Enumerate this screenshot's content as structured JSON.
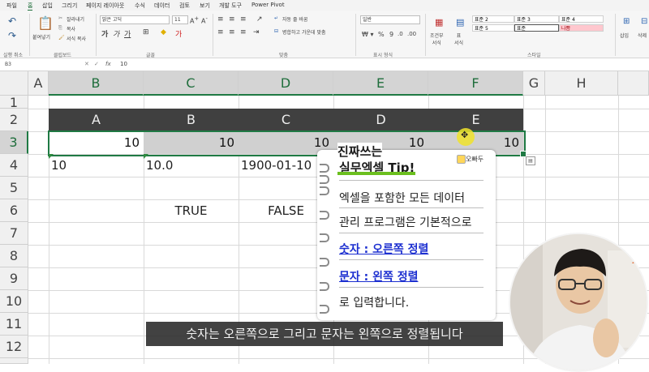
{
  "menu": [
    "파일",
    "홈",
    "삽입",
    "그리기",
    "페이지 레이아웃",
    "수식",
    "데이터",
    "검토",
    "보기",
    "개발 도구",
    "Power Pivot"
  ],
  "ribbon": {
    "clipboard": {
      "paste": "붙여넣기",
      "cut": "잘라내기",
      "copy": "복사",
      "format_painter": "서식 복사",
      "label": "클립보드"
    },
    "undo_label": "실행 취소",
    "font": {
      "name": "맑은 고딕",
      "size": "11",
      "label": "글꼴"
    },
    "alignment": {
      "wrap": "자동 줄 바꿈",
      "merge": "병합하고 가운데 맞춤",
      "label": "맞춤"
    },
    "number": {
      "format": "일반",
      "label": "표시 형식"
    },
    "styles": {
      "cond": "조건부\n서식",
      "table": "표\n서식",
      "items": [
        "표준 2",
        "표준 3",
        "표준 4",
        "표준 5",
        "표준",
        "나쁨"
      ],
      "label": "스타일"
    },
    "cells": {
      "insert": "삽입",
      "delete": "삭제"
    }
  },
  "formula_bar": {
    "name_box": "B3",
    "fx": "fx",
    "value": "10"
  },
  "columns": [
    "A",
    "B",
    "C",
    "D",
    "E",
    "F",
    "G",
    "H"
  ],
  "rows": [
    "1",
    "2",
    "3",
    "4",
    "5",
    "6",
    "7",
    "8",
    "9",
    "10",
    "11",
    "12"
  ],
  "sheet": {
    "row2": [
      "A",
      "B",
      "C",
      "D",
      "E"
    ],
    "row3": [
      "10",
      "10",
      "10",
      "10",
      "10"
    ],
    "row4": {
      "b": "10",
      "c": "10.0",
      "d": "1900-01-10"
    },
    "row6": {
      "c": "TRUE",
      "d": "FALSE"
    }
  },
  "note": {
    "title1": "진짜쓰는",
    "title2": "실무엑셀 Tip!",
    "brand": "오빠두",
    "lines": [
      "엑셀을 포함한 모든 데이터",
      "관리 프로그램은 기본적으로",
      "숫자 : 오른쪽 정렬",
      "문자 : 왼쪽 정렬",
      "로 입력합니다."
    ]
  },
  "caption": "숫자는 오른쪽으로 그리고 문자는 왼쪽으로 정렬됩니다",
  "colors": {
    "header_fill": "#404040",
    "selected_row": "#d0d0d0",
    "accent": "#1f7a44",
    "highlight": "#f0e32a"
  }
}
